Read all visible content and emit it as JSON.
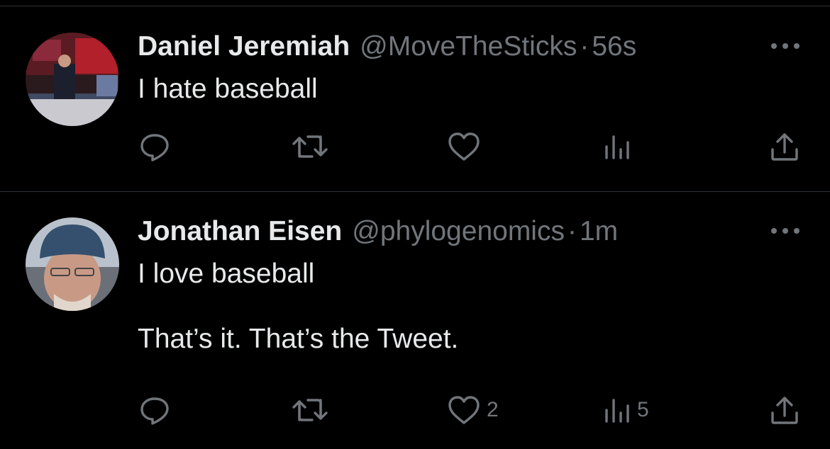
{
  "tweets": [
    {
      "name": "Daniel Jeremiah",
      "handle": "@MoveTheSticks",
      "separator": "·",
      "time": "56s",
      "text": "I hate baseball",
      "reply_count": "",
      "retweet_count": "",
      "like_count": "",
      "view_count": ""
    },
    {
      "name": "Jonathan Eisen",
      "handle": "@phylogenomics",
      "separator": "·",
      "time": "1m",
      "text": "I love baseball\n\nThat’s it. That’s the Tweet.",
      "reply_count": "",
      "retweet_count": "",
      "like_count": "2",
      "view_count": "5"
    }
  ],
  "icons": {
    "reply": "reply-icon",
    "retweet": "retweet-icon",
    "like": "heart-icon",
    "views": "views-icon",
    "share": "share-icon",
    "more": "more-icon"
  },
  "colors": {
    "background": "#000000",
    "primary_text": "#e7e9ea",
    "secondary_text": "#71767b",
    "divider": "#2f3336"
  }
}
